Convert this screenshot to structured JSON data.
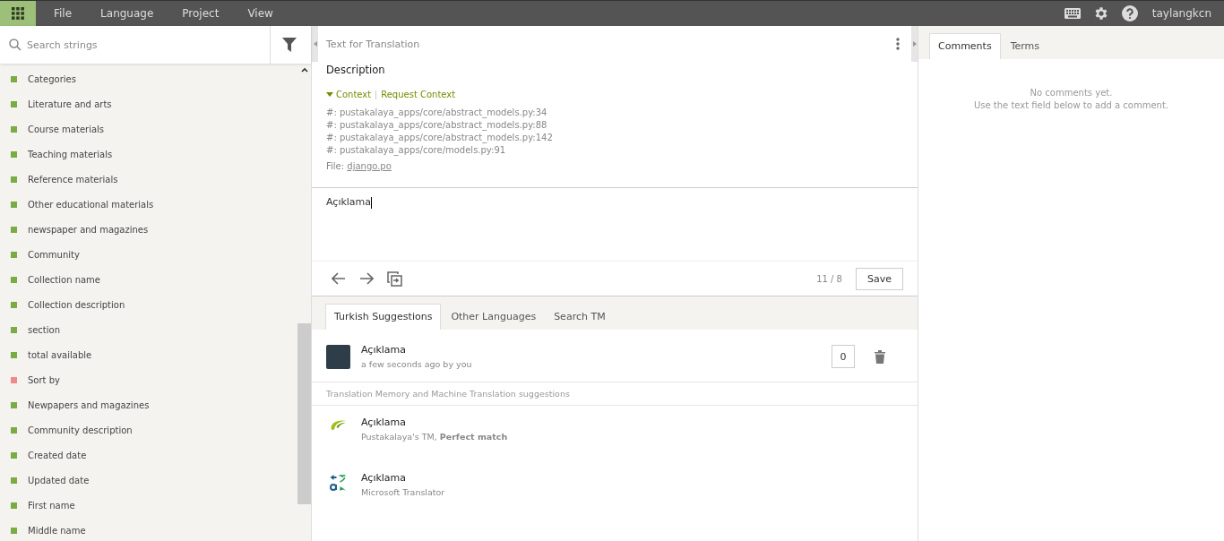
{
  "menu": [
    "File",
    "Language",
    "Project",
    "View"
  ],
  "user": "taylangkcn",
  "search": {
    "placeholder": "Search strings"
  },
  "strings": [
    {
      "label": "Categories",
      "color": "#7aab45"
    },
    {
      "label": "Literature and arts",
      "color": "#7aab45"
    },
    {
      "label": "Course materials",
      "color": "#7aab45"
    },
    {
      "label": "Teaching materials",
      "color": "#7aab45"
    },
    {
      "label": "Reference materials",
      "color": "#7aab45"
    },
    {
      "label": "Other educational materials",
      "color": "#7aab45"
    },
    {
      "label": "newspaper and magazines",
      "color": "#7aab45"
    },
    {
      "label": "Community",
      "color": "#7aab45"
    },
    {
      "label": "Collection name",
      "color": "#7aab45"
    },
    {
      "label": "Collection description",
      "color": "#7aab45"
    },
    {
      "label": "section",
      "color": "#7aab45"
    },
    {
      "label": "total available",
      "color": "#7aab45"
    },
    {
      "label": "Sort by",
      "color": "#f08a8a"
    },
    {
      "label": "Newpapers and magazines",
      "color": "#7aab45"
    },
    {
      "label": "Community description",
      "color": "#7aab45"
    },
    {
      "label": "Created date",
      "color": "#7aab45"
    },
    {
      "label": "Updated date",
      "color": "#7aab45"
    },
    {
      "label": "First name",
      "color": "#7aab45"
    },
    {
      "label": "Middle name",
      "color": "#7aab45"
    }
  ],
  "source": {
    "heading": "Text for Translation",
    "text": "Description",
    "context_link": "Context",
    "request_link": "Request Context",
    "paths": [
      "#: pustakalaya_apps/core/abstract_models.py:34",
      "#: pustakalaya_apps/core/abstract_models.py:88",
      "#: pustakalaya_apps/core/abstract_models.py:142",
      "#: pustakalaya_apps/core/models.py:91"
    ],
    "file_label": "File:",
    "file_link": "django.po"
  },
  "translation": {
    "value": "Açıklama",
    "counter": "11 / 8",
    "save": "Save"
  },
  "suggestion_tabs": [
    {
      "label": "Turkish Suggestions",
      "selected": true
    },
    {
      "label": "Other Languages",
      "selected": false
    },
    {
      "label": "Search TM",
      "selected": false
    }
  ],
  "own_suggestion": {
    "text": "Açıklama",
    "meta": "a few seconds ago by you",
    "votes": "0"
  },
  "machine_heading": "Translation Memory and Machine Translation suggestions",
  "machine_suggestions": [
    {
      "kind": "tm",
      "text": "Açıklama",
      "source": "Pustakalaya's TM, **Perfect match**"
    },
    {
      "kind": "mt",
      "text": "Açıklama",
      "source": "Microsoft Translator"
    }
  ],
  "side_tabs": [
    {
      "label": "Comments",
      "selected": true
    },
    {
      "label": "Terms",
      "selected": false
    }
  ],
  "comments_empty": [
    "No comments yet.",
    "Use the text field below to add a comment."
  ]
}
